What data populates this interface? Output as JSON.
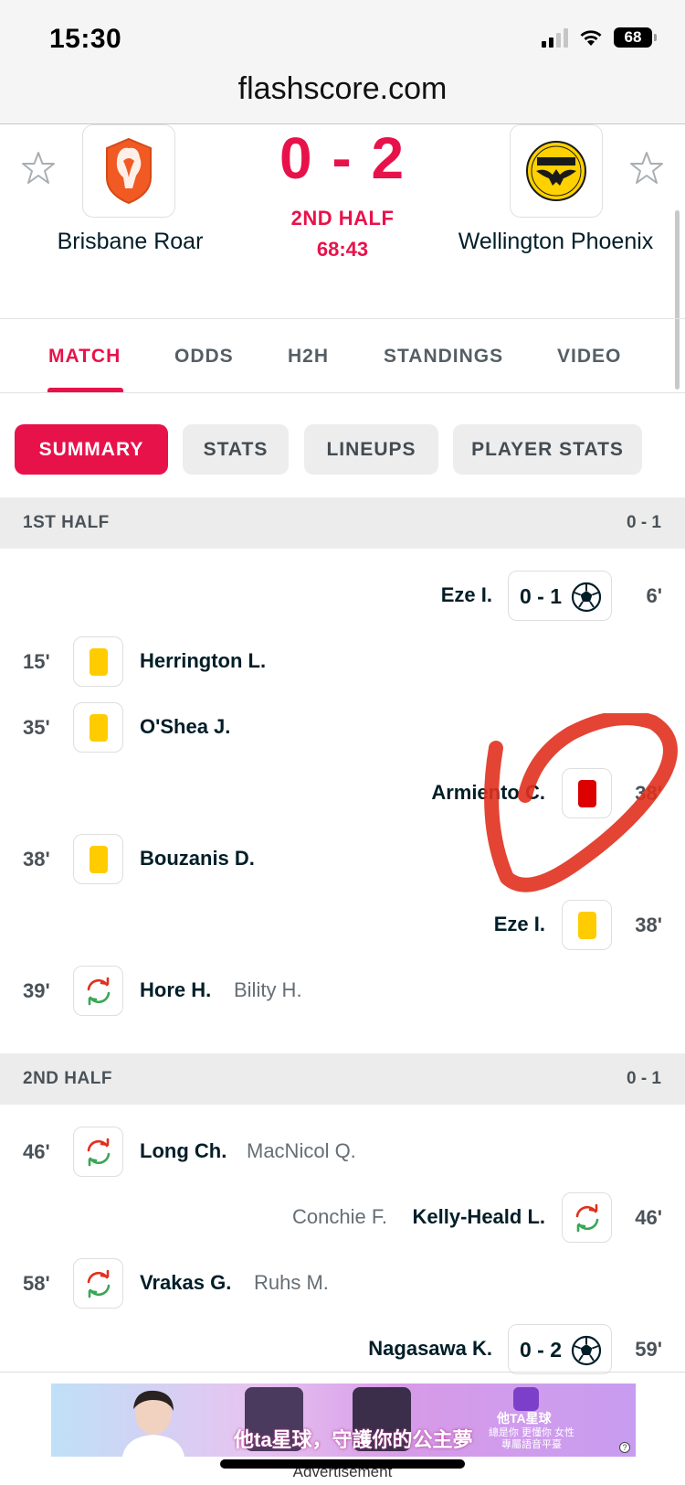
{
  "status_bar": {
    "time": "15:30",
    "battery": "68"
  },
  "browser": {
    "url": "flashscore.com"
  },
  "match": {
    "home": {
      "name": "Brisbane Roar"
    },
    "away": {
      "name": "Wellington Phoenix"
    },
    "score": "0 - 2",
    "phase": "2ND HALF",
    "clock": "68:43"
  },
  "tabs": [
    {
      "label": "MATCH",
      "active": true
    },
    {
      "label": "ODDS"
    },
    {
      "label": "H2H"
    },
    {
      "label": "STANDINGS"
    },
    {
      "label": "VIDEO"
    }
  ],
  "subtabs": [
    {
      "label": "SUMMARY",
      "active": true
    },
    {
      "label": "STATS"
    },
    {
      "label": "LINEUPS"
    },
    {
      "label": "PLAYER STATS"
    }
  ],
  "first_half": {
    "title": "1ST HALF",
    "score": "0 - 1",
    "incidents": [
      {
        "side": "away",
        "type": "goal",
        "minute": "6'",
        "player": "Eze I.",
        "score": "0 - 1"
      },
      {
        "side": "home",
        "type": "yellow-card",
        "minute": "15'",
        "player": "Herrington L."
      },
      {
        "side": "home",
        "type": "yellow-card",
        "minute": "35'",
        "player": "O'Shea J."
      },
      {
        "side": "away",
        "type": "red-card",
        "minute": "38'",
        "player": "Armiento C."
      },
      {
        "side": "home",
        "type": "yellow-card",
        "minute": "38'",
        "player": "Bouzanis D."
      },
      {
        "side": "away",
        "type": "yellow-card",
        "minute": "38'",
        "player": "Eze I."
      },
      {
        "side": "home",
        "type": "substitution",
        "minute": "39'",
        "player": "Hore H.",
        "player_out": "Bility H."
      }
    ]
  },
  "second_half": {
    "title": "2ND HALF",
    "score": "0 - 1",
    "incidents": [
      {
        "side": "home",
        "type": "substitution",
        "minute": "46'",
        "player": "Long Ch.",
        "player_out": "MacNicol Q."
      },
      {
        "side": "away",
        "type": "substitution",
        "minute": "46'",
        "player": "Kelly-Heald L.",
        "player_out": "Conchie F."
      },
      {
        "side": "home",
        "type": "substitution",
        "minute": "58'",
        "player": "Vrakas G.",
        "player_out": "Ruhs M."
      },
      {
        "side": "away",
        "type": "goal",
        "minute": "59'",
        "player": "Nagasawa K.",
        "score": "0 - 2"
      }
    ]
  },
  "ad": {
    "caption": "他ta星球，守護你的公主夢",
    "brand": "他TA星球",
    "tagline": "總是你 更懂你 女性專屬語音平臺",
    "label": "Advertisement"
  },
  "colors": {
    "accent": "#e8124a",
    "yellow_card": "#ffcc00",
    "red_card": "#dc0000",
    "annotation": "#e0301e"
  }
}
